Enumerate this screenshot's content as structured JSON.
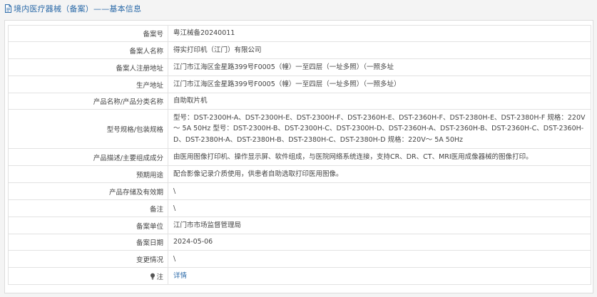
{
  "header": {
    "title": "境内医疗器械（备案）——基本信息",
    "icon": "document-icon"
  },
  "rows": [
    {
      "label": "备案号",
      "value": "粤江械备20240011"
    },
    {
      "label": "备案人名称",
      "value": "得实打印机（江门）有限公司"
    },
    {
      "label": "备案人注册地址",
      "value": "江门市江海区金星路399号F0005（幢）一至四层（一址多照）（一照多址"
    },
    {
      "label": "生产地址",
      "value": "江门市江海区金星路399号F0005（幢）一至四层（一址多照）（一照多址）"
    },
    {
      "label": "产品名称/产品分类名称",
      "value": "自助取片机"
    },
    {
      "label": "型号规格/包装规格",
      "value": "型号：DST-2300H-A、DST-2300H-E、DST-2300H-F、DST-2360H-E、DST-2360H-F、DST-2380H-E、DST-2380H-F 规格：220V～ 5A 50Hz 型号：DST-2300H-B、DST-2300H-C、DST-2300H-D、DST-2360H-A、DST-2360H-B、DST-2360H-C、DST-2360H-D、DST-2380H-A、DST-2380H-B、DST-2380H-C、DST-2380H-D 规格：220V～ 5A 50Hz"
    },
    {
      "label": "产品描述/主要组成成分",
      "value": "由医用图像打印机、操作显示屏、软件组成，与医院网络系统连接，支持CR、DR、CT、MRI医用成像器械的图像打印。"
    },
    {
      "label": "预期用途",
      "value": "配合影像记录介质使用，供患者自助选取打印医用图像。"
    },
    {
      "label": "产品存储及有效期",
      "value": "\\"
    },
    {
      "label": "备注",
      "value": "\\"
    },
    {
      "label": "备案单位",
      "value": "江门市市场监督管理局"
    },
    {
      "label": "备案日期",
      "value": "2024-05-06"
    },
    {
      "label": "变更情况",
      "value": "\\"
    },
    {
      "label": "注",
      "value": "详情",
      "icon": "lightbulb-icon"
    }
  ]
}
